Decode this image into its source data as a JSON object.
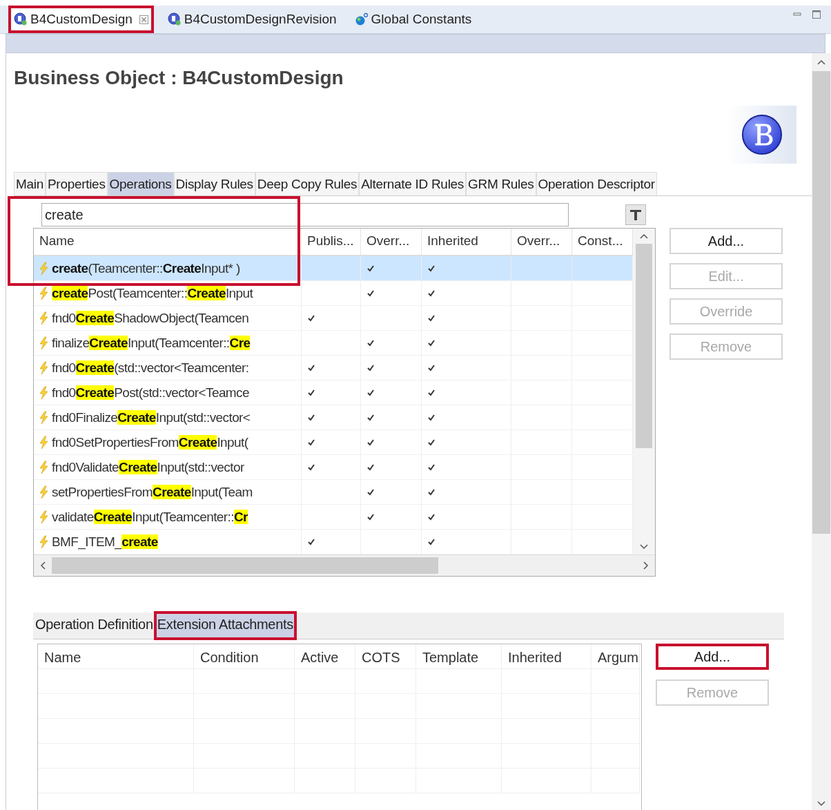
{
  "editor_tabs": [
    {
      "label": "B4CustomDesign",
      "selected": true,
      "closable": true,
      "highlighted": true
    },
    {
      "label": "B4CustomDesignRevision",
      "selected": false,
      "closable": false,
      "highlighted": false
    },
    {
      "label": "Global Constants",
      "selected": false,
      "closable": false,
      "highlighted": false
    }
  ],
  "title": "Business Object : B4CustomDesign",
  "tabs": [
    {
      "label": "Main",
      "selected": false
    },
    {
      "label": "Properties",
      "selected": false
    },
    {
      "label": "Operations",
      "selected": true
    },
    {
      "label": "Display Rules",
      "selected": false
    },
    {
      "label": "Deep Copy Rules",
      "selected": false
    },
    {
      "label": "Alternate ID Rules",
      "selected": false
    },
    {
      "label": "GRM Rules",
      "selected": false
    },
    {
      "label": "Operation Descriptor",
      "selected": false
    }
  ],
  "operations": {
    "filter": {
      "value": "create",
      "highlighted": true
    },
    "columns": [
      "Name",
      "Publis...",
      "Overr...",
      "Inherited",
      "Overr...",
      "Const..."
    ],
    "rows": [
      {
        "selected": true,
        "name": [
          {
            "text": "create",
            "match": true
          },
          {
            "text": "(Teamcenter::",
            "match": false
          },
          {
            "text": "Create",
            "match": true
          },
          {
            "text": "Input* )",
            "match": false
          }
        ],
        "published": false,
        "overridden": true,
        "inherited": true
      },
      {
        "selected": false,
        "name": [
          {
            "text": "create",
            "match": true
          },
          {
            "text": "Post(Teamcenter::",
            "match": false
          },
          {
            "text": "Create",
            "match": true
          },
          {
            "text": "Input",
            "match": false
          }
        ],
        "published": false,
        "overridden": true,
        "inherited": true
      },
      {
        "selected": false,
        "name": [
          {
            "text": "fnd0",
            "match": false
          },
          {
            "text": "Create",
            "match": true
          },
          {
            "text": "ShadowObject(Teamcen",
            "match": false
          }
        ],
        "published": true,
        "overridden": false,
        "inherited": true
      },
      {
        "selected": false,
        "name": [
          {
            "text": "finalize",
            "match": false
          },
          {
            "text": "Create",
            "match": true
          },
          {
            "text": "Input(Teamcenter::",
            "match": false
          },
          {
            "text": "Cre",
            "match": true
          }
        ],
        "published": false,
        "overridden": true,
        "inherited": true
      },
      {
        "selected": false,
        "name": [
          {
            "text": "fnd0",
            "match": false
          },
          {
            "text": "Create",
            "match": true
          },
          {
            "text": "(std::vector<Teamcenter:",
            "match": false
          }
        ],
        "published": true,
        "overridden": true,
        "inherited": true
      },
      {
        "selected": false,
        "name": [
          {
            "text": "fnd0",
            "match": false
          },
          {
            "text": "Create",
            "match": true
          },
          {
            "text": "Post(std::vector<Teamce",
            "match": false
          }
        ],
        "published": true,
        "overridden": true,
        "inherited": true
      },
      {
        "selected": false,
        "name": [
          {
            "text": "fnd0Finalize",
            "match": false
          },
          {
            "text": "Create",
            "match": true
          },
          {
            "text": "Input(std::vector<",
            "match": false
          }
        ],
        "published": true,
        "overridden": true,
        "inherited": true
      },
      {
        "selected": false,
        "name": [
          {
            "text": "fnd0SetPropertiesFrom",
            "match": false
          },
          {
            "text": "Create",
            "match": true
          },
          {
            "text": "Input(",
            "match": false
          }
        ],
        "published": true,
        "overridden": true,
        "inherited": true
      },
      {
        "selected": false,
        "name": [
          {
            "text": "fnd0Validate",
            "match": false
          },
          {
            "text": "Create",
            "match": true
          },
          {
            "text": "Input(std::vector",
            "match": false
          }
        ],
        "published": true,
        "overridden": true,
        "inherited": true
      },
      {
        "selected": false,
        "name": [
          {
            "text": "setPropertiesFrom",
            "match": false
          },
          {
            "text": "Create",
            "match": true
          },
          {
            "text": "Input(Team",
            "match": false
          }
        ],
        "published": false,
        "overridden": true,
        "inherited": true
      },
      {
        "selected": false,
        "name": [
          {
            "text": "validate",
            "match": false
          },
          {
            "text": "Create",
            "match": true
          },
          {
            "text": "Input(Teamcenter::",
            "match": false
          },
          {
            "text": "Cr",
            "match": true
          }
        ],
        "published": false,
        "overridden": true,
        "inherited": true
      },
      {
        "selected": false,
        "name": [
          {
            "text": "BMF_ITEM_",
            "match": false
          },
          {
            "text": "create",
            "match": true
          }
        ],
        "published": true,
        "overridden": false,
        "inherited": true
      }
    ],
    "buttons": [
      {
        "label": "Add...",
        "disabled": false
      },
      {
        "label": "Edit...",
        "disabled": true
      },
      {
        "label": "Override",
        "disabled": true
      },
      {
        "label": "Remove",
        "disabled": true
      }
    ]
  },
  "detail_tabs": [
    {
      "label": "Operation Definition",
      "selected": false,
      "highlighted": false
    },
    {
      "label": "Extension Attachments",
      "selected": true,
      "highlighted": true
    }
  ],
  "attachments": {
    "columns": [
      "Name",
      "Condition",
      "Active",
      "COTS",
      "Template",
      "Inherited",
      "Argum"
    ],
    "buttons": [
      {
        "label": "Add...",
        "disabled": false,
        "highlighted": true
      },
      {
        "label": "Remove",
        "disabled": true,
        "highlighted": false
      }
    ]
  }
}
